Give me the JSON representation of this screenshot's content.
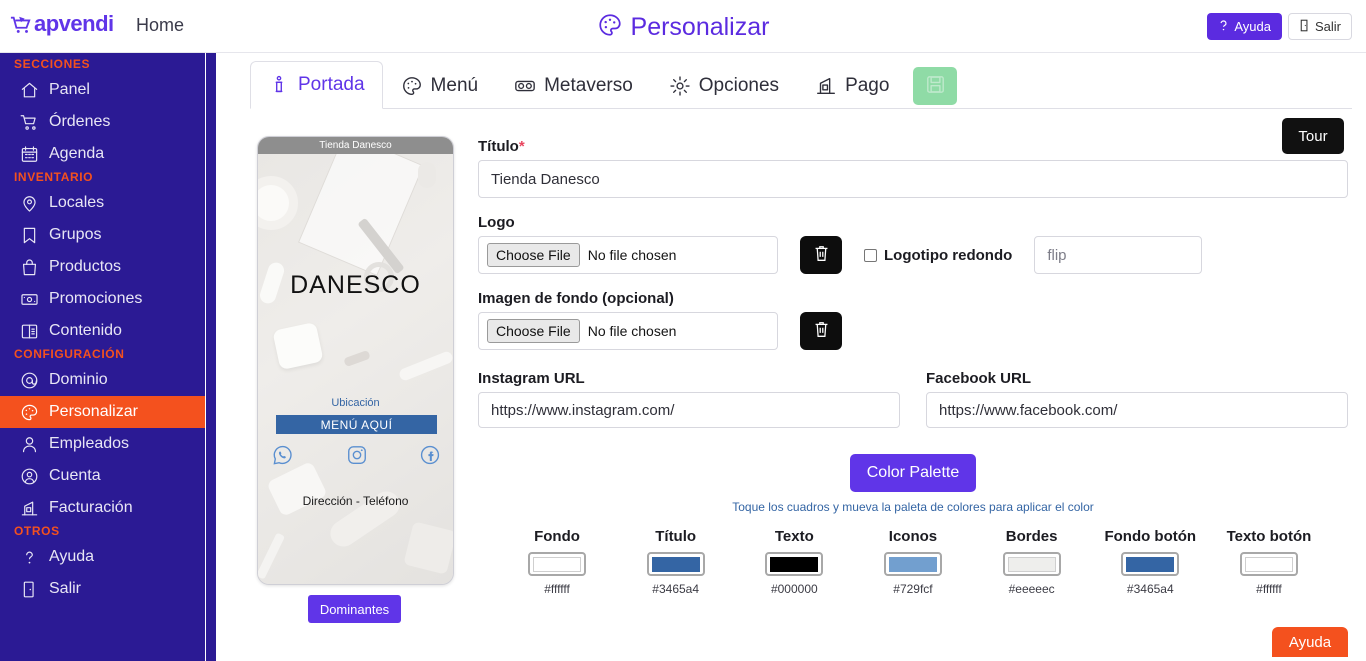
{
  "topbar": {
    "brand": "apvendi",
    "nav_home": "Home",
    "page_title": "Personalizar",
    "help_button": "Ayuda",
    "logout_button": "Salir"
  },
  "sidebar": {
    "groups": [
      {
        "label": "SECCIONES",
        "items": [
          {
            "label": "Panel",
            "icon": "home-icon",
            "active": false
          },
          {
            "label": "Órdenes",
            "icon": "cart-icon",
            "active": false
          },
          {
            "label": "Agenda",
            "icon": "calendar-icon",
            "active": false
          }
        ]
      },
      {
        "label": "INVENTARIO",
        "items": [
          {
            "label": "Locales",
            "icon": "pin-icon",
            "active": false
          },
          {
            "label": "Grupos",
            "icon": "bookmark-icon",
            "active": false
          },
          {
            "label": "Productos",
            "icon": "bag-icon",
            "active": false
          },
          {
            "label": "Promociones",
            "icon": "money-icon",
            "active": false
          },
          {
            "label": "Contenido",
            "icon": "book-icon",
            "active": false
          }
        ]
      },
      {
        "label": "CONFIGURACIÓN",
        "items": [
          {
            "label": "Dominio",
            "icon": "at-icon",
            "active": false
          },
          {
            "label": "Personalizar",
            "icon": "palette-icon",
            "active": true
          },
          {
            "label": "Empleados",
            "icon": "user-icon",
            "active": false
          },
          {
            "label": "Cuenta",
            "icon": "user-circle-icon",
            "active": false
          },
          {
            "label": "Facturación",
            "icon": "invoice-icon",
            "active": false
          }
        ]
      },
      {
        "label": "OTROS",
        "items": [
          {
            "label": "Ayuda",
            "icon": "question-icon",
            "active": false
          },
          {
            "label": "Salir",
            "icon": "exit-icon",
            "active": false
          }
        ]
      }
    ]
  },
  "tabs": [
    {
      "label": "Portada",
      "icon": "info-pin-icon",
      "active": true
    },
    {
      "label": "Menú",
      "icon": "palette-icon",
      "active": false
    },
    {
      "label": "Metaverso",
      "icon": "vr-goggles-icon",
      "active": false
    },
    {
      "label": "Opciones",
      "icon": "gear-icon",
      "active": false
    },
    {
      "label": "Pago",
      "icon": "payment-icon",
      "active": false
    }
  ],
  "save_tab": {
    "icon": "floppy-disk-icon",
    "color": "#8fdba6"
  },
  "tour_button": "Tour",
  "preview": {
    "header_title": "Tienda Danesco",
    "brand_text": "DANESCO",
    "location_link": "Ubicación",
    "menu_button": "MENÚ AQUÍ",
    "address_text": "Dirección - Teléfono",
    "social": [
      "whatsapp-icon",
      "instagram-icon",
      "facebook-icon"
    ],
    "dominantes_button": "Dominantes"
  },
  "form": {
    "titulo_label": "Título",
    "titulo_required_mark": "*",
    "titulo_value": "Tienda Danesco",
    "logo_label": "Logo",
    "logo_choose_file": "Choose File",
    "logo_no_file": "No file chosen",
    "logo_redondo_label": "Logotipo redondo",
    "logo_redondo_checked": false,
    "flip_placeholder": "flip",
    "flip_value": "",
    "fondo_label": "Imagen de fondo (opcional)",
    "fondo_choose_file": "Choose File",
    "fondo_no_file": "No file chosen",
    "instagram_label": "Instagram URL",
    "instagram_value": "https://www.instagram.com/",
    "facebook_label": "Facebook URL",
    "facebook_value": "https://www.facebook.com/",
    "palette_button": "Color Palette",
    "palette_hint": "Toque los cuadros y mueva la paleta de colores para aplicar el color"
  },
  "swatches": [
    {
      "name": "Fondo",
      "hex": "#ffffff"
    },
    {
      "name": "Título",
      "hex": "#3465a4"
    },
    {
      "name": "Texto",
      "hex": "#000000"
    },
    {
      "name": "Iconos",
      "hex": "#729fcf"
    },
    {
      "name": "Bordes",
      "hex": "#eeeeec"
    },
    {
      "name": "Fondo botón",
      "hex": "#3465a4"
    },
    {
      "name": "Texto botón",
      "hex": "#ffffff"
    }
  ],
  "floating_help": "Ayuda"
}
